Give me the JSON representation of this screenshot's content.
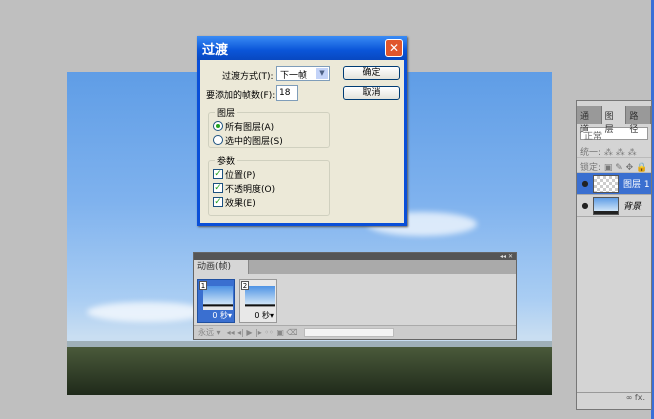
{
  "dialog": {
    "title": "过渡",
    "method_label": "过渡方式(T):",
    "method_value": "下一帧",
    "frames_label": "要添加的帧数(F):",
    "frames_value": "18",
    "ok": "确定",
    "cancel": "取消",
    "layers_group": "图层",
    "all_layers": "所有图层(A)",
    "selected_layers": "选中的图层(S)",
    "params_group": "参数",
    "position": "位置(P)",
    "opacity": "不透明度(O)",
    "effects": "效果(E)"
  },
  "animation": {
    "tab": "动画(帧)",
    "frames": [
      {
        "num": "1",
        "delay": "0 秒▾"
      },
      {
        "num": "2",
        "delay": "0 秒▾"
      }
    ],
    "loop": "永远 ▾",
    "controls": "◂◂  ◂|  ▶  |▸  ◦◦  ▣  ⌫"
  },
  "layers_panel": {
    "tabs": [
      "通道",
      "图层",
      "路径"
    ],
    "blend_mode": "正常",
    "unify": "统一: ⁂ ⁂ ⁂",
    "lock": "锁定: ▣ ✎ ✥ 🔒",
    "layers": [
      {
        "name": "图层 1"
      },
      {
        "name": "背景"
      }
    ],
    "footer": "∞ fx."
  }
}
